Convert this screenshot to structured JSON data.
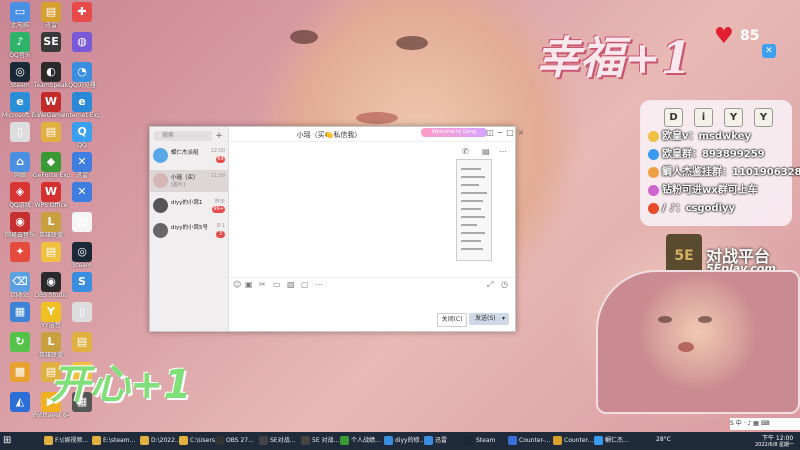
{
  "desktop_icons": [
    {
      "label": "此电脑",
      "color": "#4a90e2",
      "glyph": "▭"
    },
    {
      "label": "QQ音乐",
      "color": "#2fb36a",
      "glyph": "♪"
    },
    {
      "label": "Steam",
      "color": "#1b2838",
      "glyph": "◎"
    },
    {
      "label": "Microsoft Edge",
      "color": "#2a8fd8",
      "glyph": "e"
    },
    {
      "label": "",
      "color": "#ddd",
      "glyph": "▯"
    },
    {
      "label": "网络",
      "color": "#4a90e2",
      "glyph": "⌂"
    },
    {
      "label": "QQ游戏",
      "color": "#d93535",
      "glyph": "◈"
    },
    {
      "label": "网易云音乐",
      "color": "#c62f2f",
      "glyph": "◉"
    },
    {
      "label": "",
      "color": "#e54b3c",
      "glyph": "✦"
    },
    {
      "label": "回收站",
      "color": "#5aa0e0",
      "glyph": "⌫"
    },
    {
      "label": "",
      "color": "#3d84d6",
      "glyph": "▦"
    },
    {
      "label": "",
      "color": "#55c24a",
      "glyph": "↻"
    },
    {
      "label": "",
      "color": "#e8a030",
      "glyph": "▩"
    },
    {
      "label": "",
      "color": "#2b6fd6",
      "glyph": "◭"
    },
    {
      "label": "迅雷",
      "color": "#d6a030",
      "glyph": "▤"
    },
    {
      "label": "",
      "color": "#3a3a3a",
      "glyph": "SE"
    },
    {
      "label": "TeamSpeak",
      "color": "#2a2a2a",
      "glyph": "◐"
    },
    {
      "label": "WeGame",
      "color": "#c52a2a",
      "glyph": "W"
    },
    {
      "label": "",
      "color": "#e0b040",
      "glyph": "▤"
    },
    {
      "label": "GeForce Experience",
      "color": "#3a9a35",
      "glyph": "◆"
    },
    {
      "label": "WPS Office",
      "color": "#d53030",
      "glyph": "W"
    },
    {
      "label": "英雄联盟",
      "color": "#c9a040",
      "glyph": "L"
    },
    {
      "label": "",
      "color": "#f0c040",
      "glyph": "▤"
    },
    {
      "label": "OBS Studio",
      "color": "#2a2a2a",
      "glyph": "◉"
    },
    {
      "label": "YY语音",
      "color": "#f0c020",
      "glyph": "Y"
    },
    {
      "label": "英雄联盟",
      "color": "#c9a040",
      "glyph": "L"
    },
    {
      "label": "",
      "color": "#e0b040",
      "glyph": "▤"
    },
    {
      "label": "PotPlayer 64 bit",
      "color": "#f0b020",
      "glyph": "▶"
    },
    {
      "label": "",
      "color": "#e84a4a",
      "glyph": "✚"
    },
    {
      "label": "",
      "color": "#7a5ad8",
      "glyph": "◍"
    },
    {
      "label": "QQ浏览器",
      "color": "#3a8ee0",
      "glyph": "◔"
    },
    {
      "label": "Internet Explorer",
      "color": "#2a88d8",
      "glyph": "e"
    },
    {
      "label": "QQ",
      "color": "#39a0f0",
      "glyph": "Q"
    },
    {
      "label": "迅雷",
      "color": "#3d7ee0",
      "glyph": "✕"
    },
    {
      "label": "",
      "color": "#3d7ee0",
      "glyph": "✕"
    },
    {
      "label": "",
      "color": "#f5f5f5",
      "glyph": "▤"
    },
    {
      "label": "Steam",
      "color": "#1b2838",
      "glyph": "◎"
    },
    {
      "label": "",
      "color": "#3a8ee0",
      "glyph": "S"
    },
    {
      "label": "",
      "color": "#ddd",
      "glyph": "▯"
    },
    {
      "label": "",
      "color": "#e0b040",
      "glyph": "▤"
    },
    {
      "label": "QQ音乐",
      "color": "#f0c040",
      "glyph": "♪"
    },
    {
      "label": "",
      "color": "#555",
      "glyph": "▦"
    }
  ],
  "qq_window": {
    "search_placeholder": "搜索",
    "plus": "+",
    "conversations": [
      {
        "name": "蝶仁杰派组",
        "preview": "",
        "time": "12:00",
        "badge": "69",
        "avatar": "#5aa7e8",
        "active": false
      },
      {
        "name": "小瑶（买）",
        "preview": "[图片]",
        "time": "11:59",
        "badge": "",
        "avatar": "#d6b5b5",
        "active": true
      },
      {
        "name": "diyy的小窝1",
        "preview": "",
        "time": "昨天",
        "badge": "99+",
        "avatar": "#555555",
        "active": false
      },
      {
        "name": "diyy的小窝5号",
        "preview": "",
        "time": "8-1",
        "badge": "3",
        "avatar": "#666666",
        "active": false
      }
    ],
    "chat_title": "小瑶（买🍋私信我）",
    "banner": "Welcome to Gang",
    "close_label": "关闭(C)",
    "send_label": "发送(S)",
    "send_arrow": "▾"
  },
  "overlays": {
    "happy_text": "幸福+1",
    "heart_count": "85",
    "kaixin_text": "开心+1",
    "diyy_keys": [
      "D",
      "i",
      "Y",
      "Y"
    ],
    "info_rows": [
      {
        "text": "欧皇v：msdwkey",
        "icon_color": "#f0c040"
      },
      {
        "text": "欧皇群：893899259",
        "icon_color": "#3a9aef"
      },
      {
        "text": "鲷人杰鉴挂群：1101906328",
        "icon_color": "#f0a040"
      },
      {
        "text": "钻粉可进wx群可上车",
        "icon_color": "#cc66cc"
      },
      {
        "text": "/ ♪：csgodiyy",
        "icon_color": "#e84a2a"
      }
    ],
    "se_logo": "5E",
    "se_title": "对战平台",
    "se_url": "5Eplay.com"
  },
  "taskbar": {
    "items": [
      {
        "label": "⊞",
        "color": "#ffffff"
      },
      {
        "label": "F:\\(娱视频...",
        "color": "#e0b040"
      },
      {
        "label": "E:\\steam...",
        "color": "#e0b040"
      },
      {
        "label": "D:\\2022...",
        "color": "#e0b040"
      },
      {
        "label": "C:\\Users...",
        "color": "#e0b040"
      },
      {
        "label": "OBS 27...",
        "color": "#333333"
      },
      {
        "label": "SE对战...",
        "color": "#444444"
      },
      {
        "label": "5E 对战...",
        "color": "#444444"
      },
      {
        "label": "个人战绩...",
        "color": "#3a9a35"
      },
      {
        "label": "diyy的修...",
        "color": "#3a8ee0"
      },
      {
        "label": "迅雷",
        "color": "#3a8ee0"
      },
      {
        "label": "Steam",
        "color": "#1b2838"
      },
      {
        "label": "Counter-...",
        "color": "#3a6ed8"
      },
      {
        "label": "Counter...",
        "color": "#d8a030"
      },
      {
        "label": "鲷仁杰...",
        "color": "#3a9aef"
      }
    ],
    "weather": "28°C",
    "time": "下午 12:00",
    "date": "2022/6/8 星期一"
  },
  "ime": "S 中 · ♪ ▦ ⌨"
}
